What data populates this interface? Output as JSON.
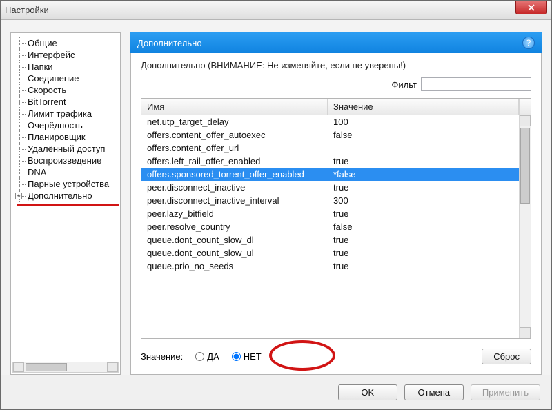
{
  "window_title": "Настройки",
  "sidebar": {
    "items": [
      {
        "label": "Общие"
      },
      {
        "label": "Интерфейс"
      },
      {
        "label": "Папки"
      },
      {
        "label": "Соединение"
      },
      {
        "label": "Скорость"
      },
      {
        "label": "BitTorrent"
      },
      {
        "label": "Лимит трафика"
      },
      {
        "label": "Очерёдность"
      },
      {
        "label": "Планировщик"
      },
      {
        "label": "Удалённый доступ"
      },
      {
        "label": "Воспроизведение"
      },
      {
        "label": "DNA"
      },
      {
        "label": "Парные устройства"
      },
      {
        "label": "Дополнительно",
        "has_plus": true
      }
    ]
  },
  "panel": {
    "title": "Дополнительно",
    "warning_text": "Дополнительно (ВНИМАНИЕ: Не изменяйте, если не уверены!)",
    "filter_label": "Фильт",
    "filter_value": "",
    "columns": {
      "name": "Имя",
      "value": "Значение"
    },
    "rows": [
      {
        "name": "net.utp_target_delay",
        "value": "100"
      },
      {
        "name": "offers.content_offer_autoexec",
        "value": "false"
      },
      {
        "name": "offers.content_offer_url",
        "value": ""
      },
      {
        "name": "offers.left_rail_offer_enabled",
        "value": "true"
      },
      {
        "name": "offers.sponsored_torrent_offer_enabled",
        "value": "*false",
        "selected": true
      },
      {
        "name": "peer.disconnect_inactive",
        "value": "true"
      },
      {
        "name": "peer.disconnect_inactive_interval",
        "value": "300"
      },
      {
        "name": "peer.lazy_bitfield",
        "value": "true"
      },
      {
        "name": "peer.resolve_country",
        "value": "false"
      },
      {
        "name": "queue.dont_count_slow_dl",
        "value": "true"
      },
      {
        "name": "queue.dont_count_slow_ul",
        "value": "true"
      },
      {
        "name": "queue.prio_no_seeds",
        "value": "true"
      }
    ],
    "value_label": "Значение:",
    "radio_yes": "ДА",
    "radio_no": "НЕТ",
    "radio_selected": "no",
    "reset_button": "Сброс"
  },
  "footer": {
    "ok": "OK",
    "cancel": "Отмена",
    "apply": "Применить"
  }
}
